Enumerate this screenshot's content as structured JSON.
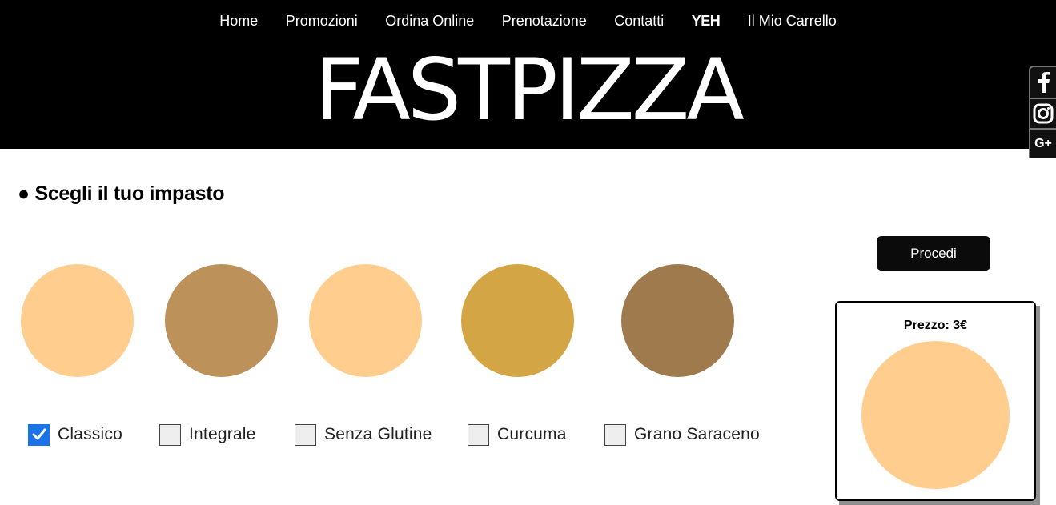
{
  "nav": {
    "items": [
      {
        "label": "Home",
        "bold": false
      },
      {
        "label": "Promozioni",
        "bold": false
      },
      {
        "label": "Ordina Online",
        "bold": false
      },
      {
        "label": "Prenotazione",
        "bold": false
      },
      {
        "label": "Contatti",
        "bold": false
      },
      {
        "label": "YEH",
        "bold": true
      },
      {
        "label": "Il Mio Carrello",
        "bold": false
      }
    ]
  },
  "brand": {
    "title": "FASTPIZZA"
  },
  "social": [
    {
      "icon": "facebook-icon"
    },
    {
      "icon": "instagram-icon"
    },
    {
      "icon": "google-plus-icon",
      "text": "G+"
    }
  ],
  "section": {
    "title": "● Scegli il tuo impasto"
  },
  "doughs": [
    {
      "label": "Classico",
      "checked": true,
      "color": "#FFCE8E",
      "rim": "#A67449"
    },
    {
      "label": "Integrale",
      "checked": false,
      "color": "#BC915A",
      "rim": "#8E6A45"
    },
    {
      "label": "Senza Glutine",
      "checked": false,
      "color": "#FFCE8E",
      "rim": "#A67449"
    },
    {
      "label": "Curcuma",
      "checked": false,
      "color": "#D4A545",
      "rim": "#9E7A34"
    },
    {
      "label": "Grano Saraceno",
      "checked": false,
      "color": "#9E7A4D",
      "rim": "#6E5235"
    }
  ],
  "actions": {
    "proceed_label": "Procedi"
  },
  "price": {
    "label": "Prezzo: 3€",
    "pizza_color": "#FFCE8E",
    "pizza_rim": "#A67449"
  },
  "colors": {
    "header_bg": "#000000",
    "checkbox_checked": "#1A73E8"
  }
}
